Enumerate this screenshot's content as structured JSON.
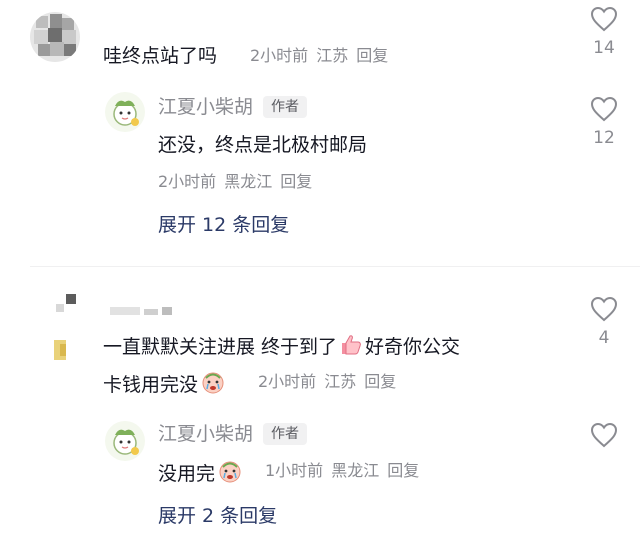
{
  "comments": [
    {
      "text": "哇终点站了吗",
      "time": "2小时前",
      "location": "江苏",
      "reply_label": "回复",
      "likes": "14",
      "reply": {
        "author": "江夏小柴胡",
        "author_tag": "作者",
        "text": "还没，终点是北极村邮局",
        "time": "2小时前",
        "location": "黑龙江",
        "reply_label": "回复",
        "likes": "12"
      },
      "expand_label": "展开 12 条回复"
    },
    {
      "text_line1": "一直默默关注进展 终于到了",
      "text_line1_after": "好奇你公交",
      "text_line2": "卡钱用完没",
      "time": "2小时前",
      "location": "江苏",
      "reply_label": "回复",
      "likes": "4",
      "reply": {
        "author": "江夏小柴胡",
        "author_tag": "作者",
        "text": "没用完",
        "time": "1小时前",
        "location": "黑龙江",
        "reply_label": "回复"
      },
      "expand_label": "展开 2 条回复"
    }
  ],
  "icons": {
    "like": "heart-outline-icon",
    "emoji_thumb": "thumbs-up-emoji-icon",
    "emoji_face": "crying-face-emoji-icon"
  }
}
